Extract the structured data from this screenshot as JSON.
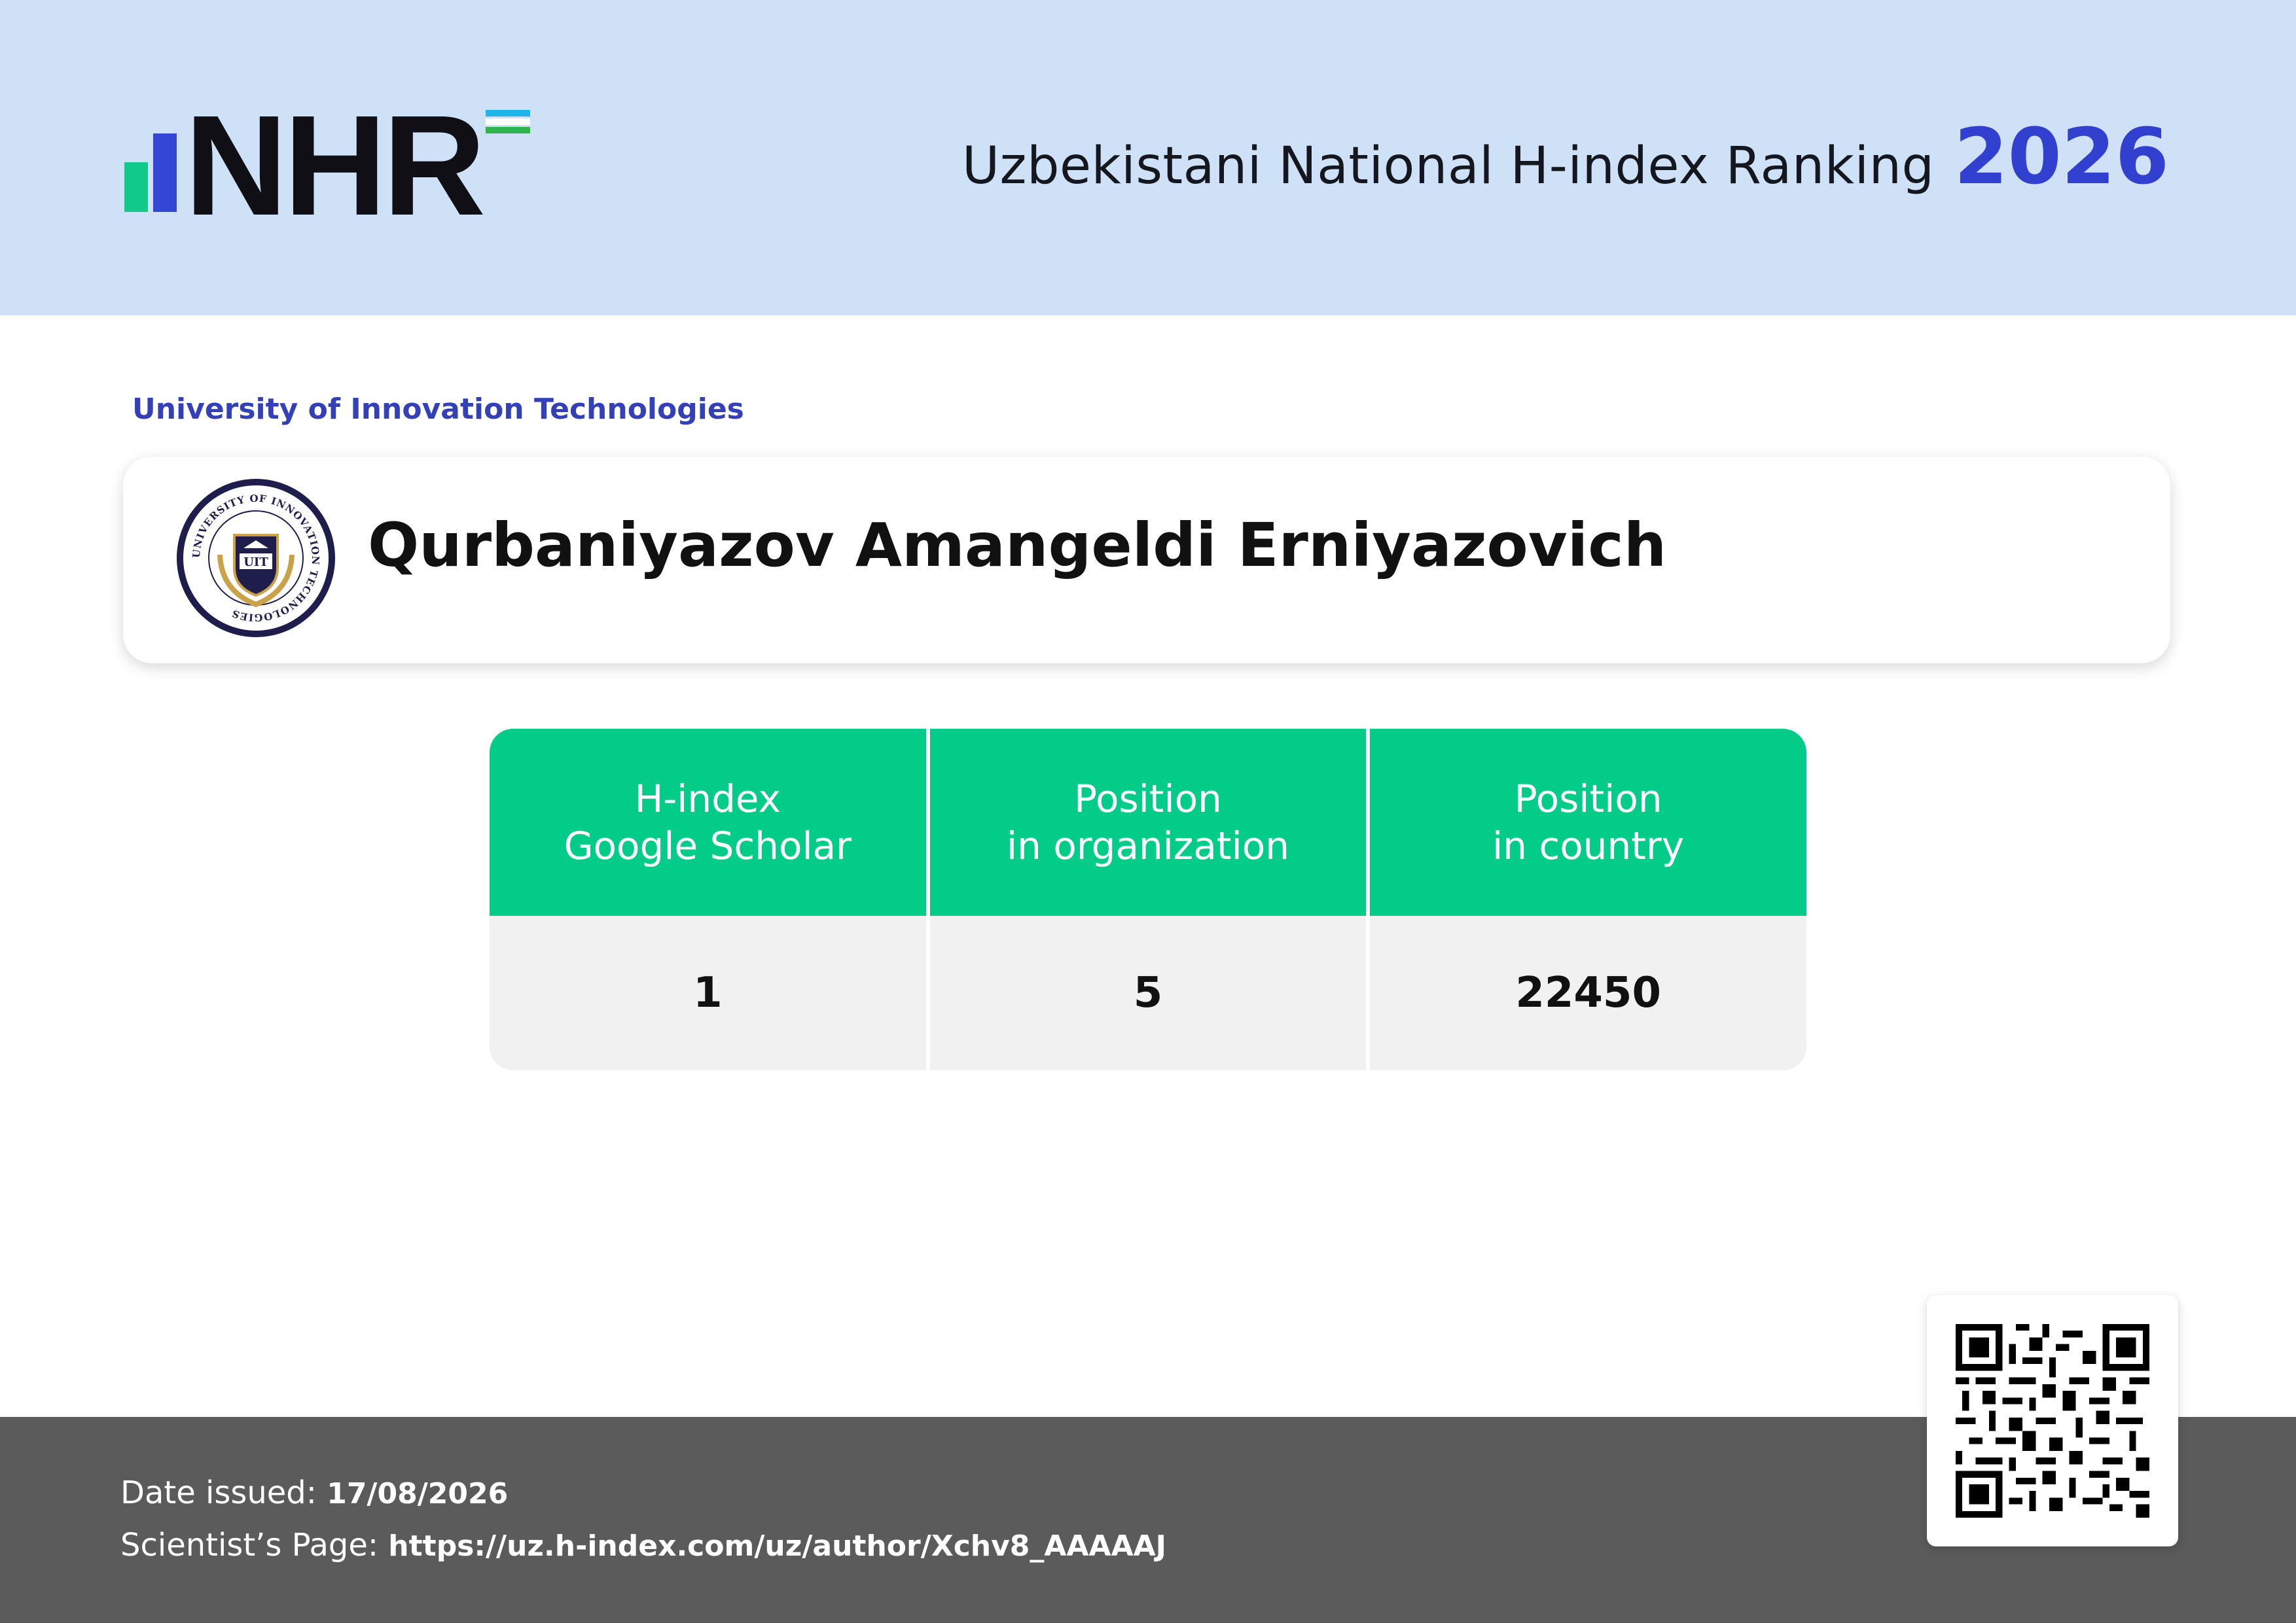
{
  "header": {
    "logo_text": "NHR",
    "title": "Uzbekistani National H-index Ranking",
    "year": "2026"
  },
  "organization": {
    "name": "University of Innovation Technologies",
    "emblem_text": "UNIVERSITY OF INNOVATION TECHNOLOGIES",
    "emblem_abbr": "UIT"
  },
  "scientist": {
    "name": "Qurbaniyazov Amangeldi Erniyazovich"
  },
  "stats": {
    "headers": [
      {
        "line1": "H-index",
        "line2": "Google Scholar"
      },
      {
        "line1": "Position",
        "line2": "in organization"
      },
      {
        "line1": "Position",
        "line2": "in country"
      }
    ],
    "values": [
      "1",
      "5",
      "22450"
    ]
  },
  "footer": {
    "date_label": "Date issued:",
    "date_value": "17/08/2026",
    "page_label": "Scientist’s Page:",
    "page_url": "https://uz.h-index.com/uz/author/Xchv8_AAAAAJ"
  },
  "colors": {
    "header_bg": "#cfe1f7",
    "accent_blue": "#3140cf",
    "table_header_green": "#03cc89",
    "footer_bg": "#5b5b5b"
  },
  "icons": [
    "nhr-logo",
    "uzbek-flag-icon",
    "university-emblem",
    "qr-code"
  ]
}
